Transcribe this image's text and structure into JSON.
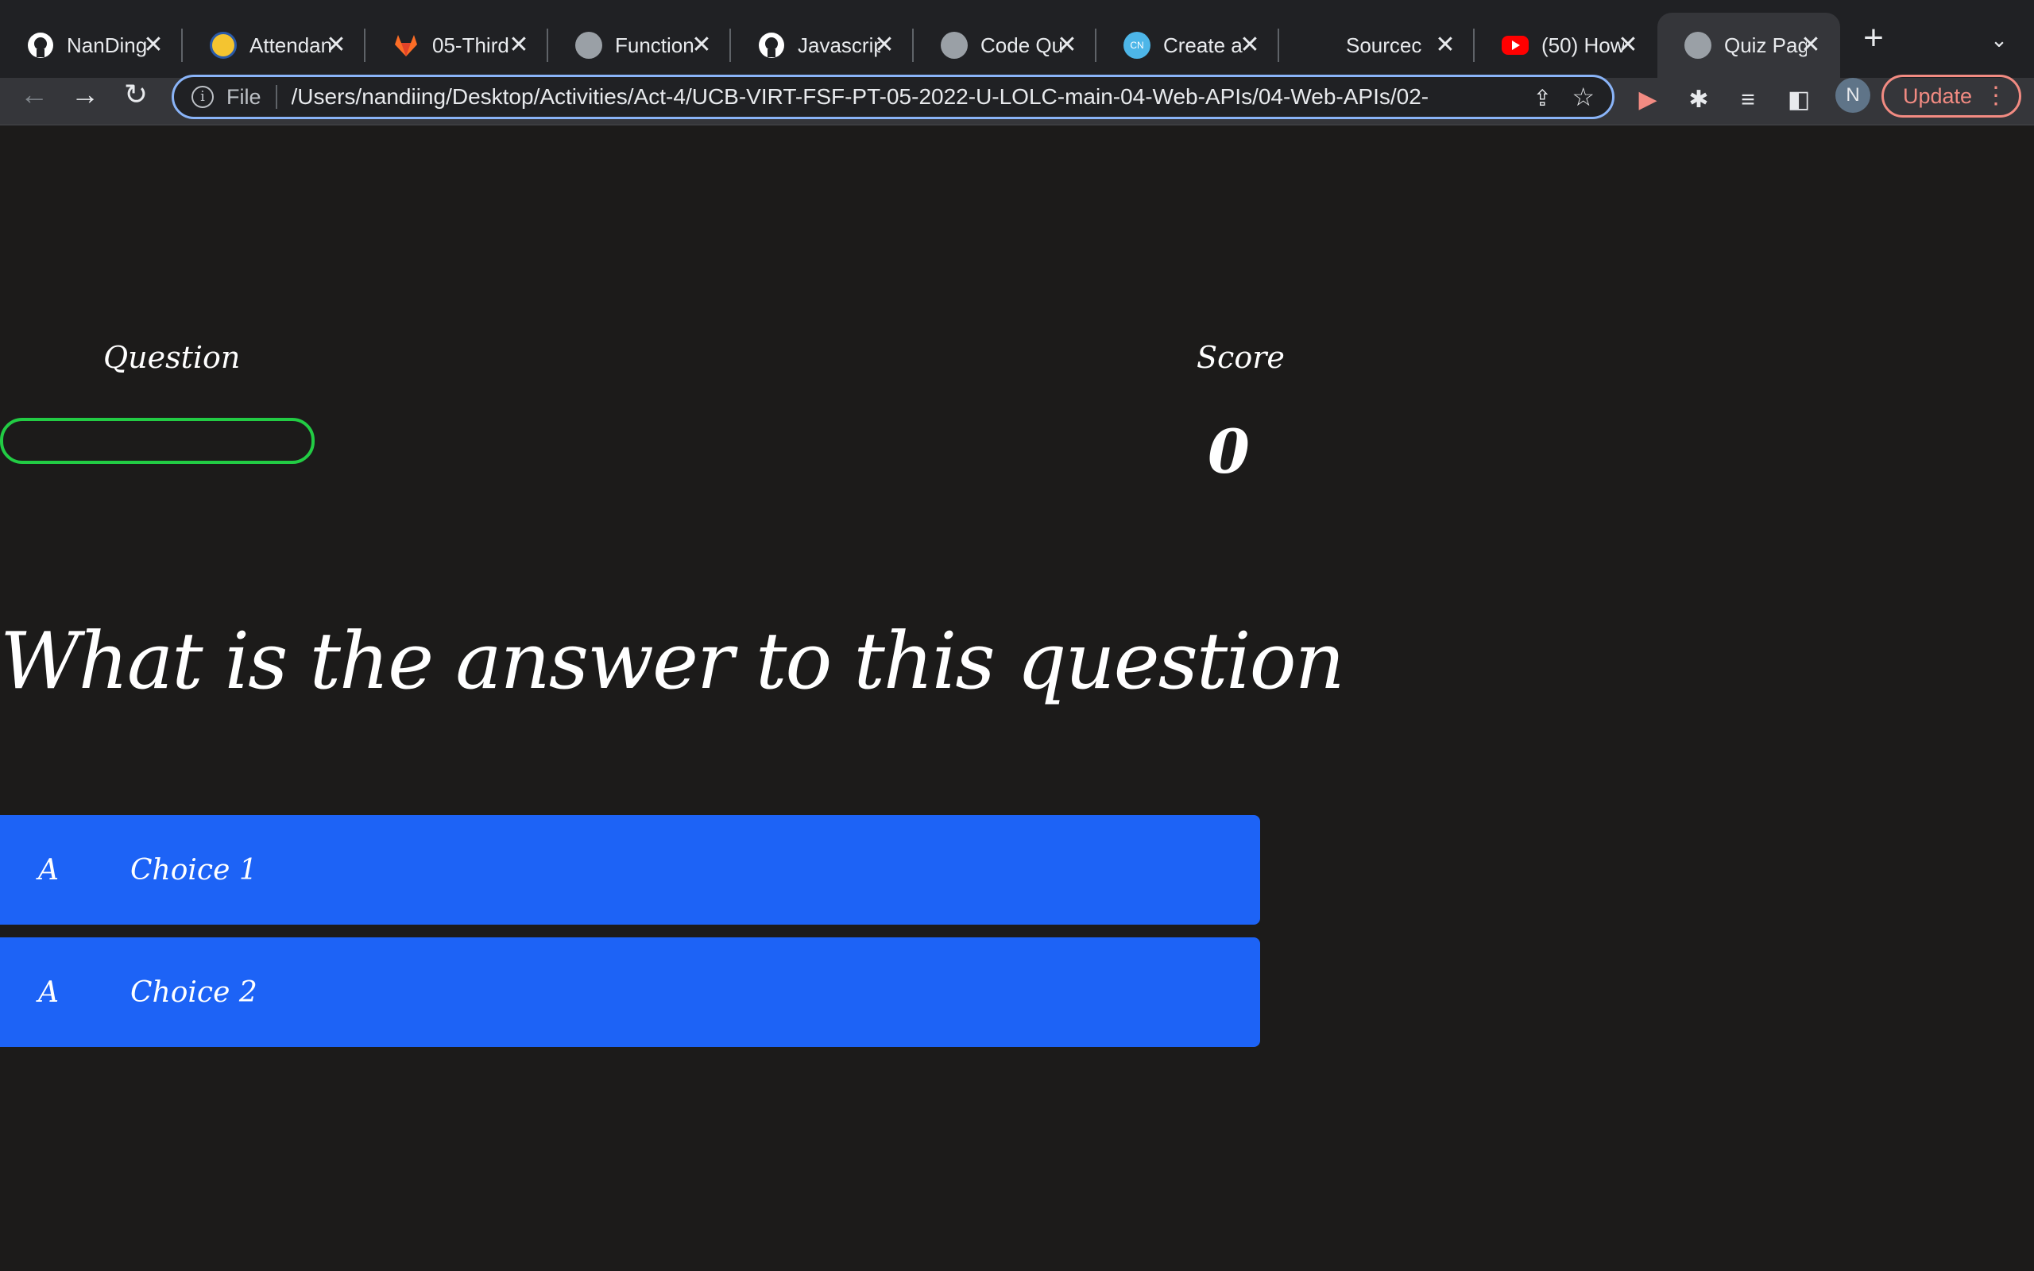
{
  "browser": {
    "tabs": [
      {
        "title": "NanDing",
        "icon": "github-icon",
        "color": "#ffffff"
      },
      {
        "title": "Attendan",
        "icon": "attendance-logo-icon",
        "color": "#f4c430"
      },
      {
        "title": "05-Third",
        "icon": "gitlab-icon",
        "color": "#fc6d26"
      },
      {
        "title": "Function",
        "icon": "globe-icon",
        "color": "#bdc1c6"
      },
      {
        "title": "Javascrip",
        "icon": "github-icon",
        "color": "#ffffff"
      },
      {
        "title": "Code Qu",
        "icon": "globe-icon",
        "color": "#bdc1c6"
      },
      {
        "title": "Create a",
        "icon": "cn-icon",
        "color": "#4db6e8"
      },
      {
        "title": "Sourcec",
        "icon": "blank-icon",
        "color": "#202124"
      },
      {
        "title": "(50) How",
        "icon": "youtube-icon",
        "color": "#ff0000"
      },
      {
        "title": "Quiz Pag",
        "icon": "globe-icon",
        "color": "#bdc1c6"
      }
    ],
    "address": {
      "scheme": "File",
      "url": "/Users/nandiing/Desktop/Activities/Act-4/UCB-VIRT-FSF-PT-05-2022-U-LOLC-main-04-Web-APIs/04-Web-APIs/02-"
    },
    "avatar_letter": "N",
    "update_label": "Update"
  },
  "quiz": {
    "question_label": "Question",
    "score_label": "Score",
    "score_value": "0",
    "question_text": "What is the answer to this question",
    "choices": [
      {
        "prefix": "A",
        "text": "Choice 1"
      },
      {
        "prefix": "A",
        "text": "Choice 2"
      }
    ],
    "colors": {
      "background": "#1c1b1a",
      "choice": "#1d63f6",
      "progress_border": "#22cc44"
    }
  }
}
